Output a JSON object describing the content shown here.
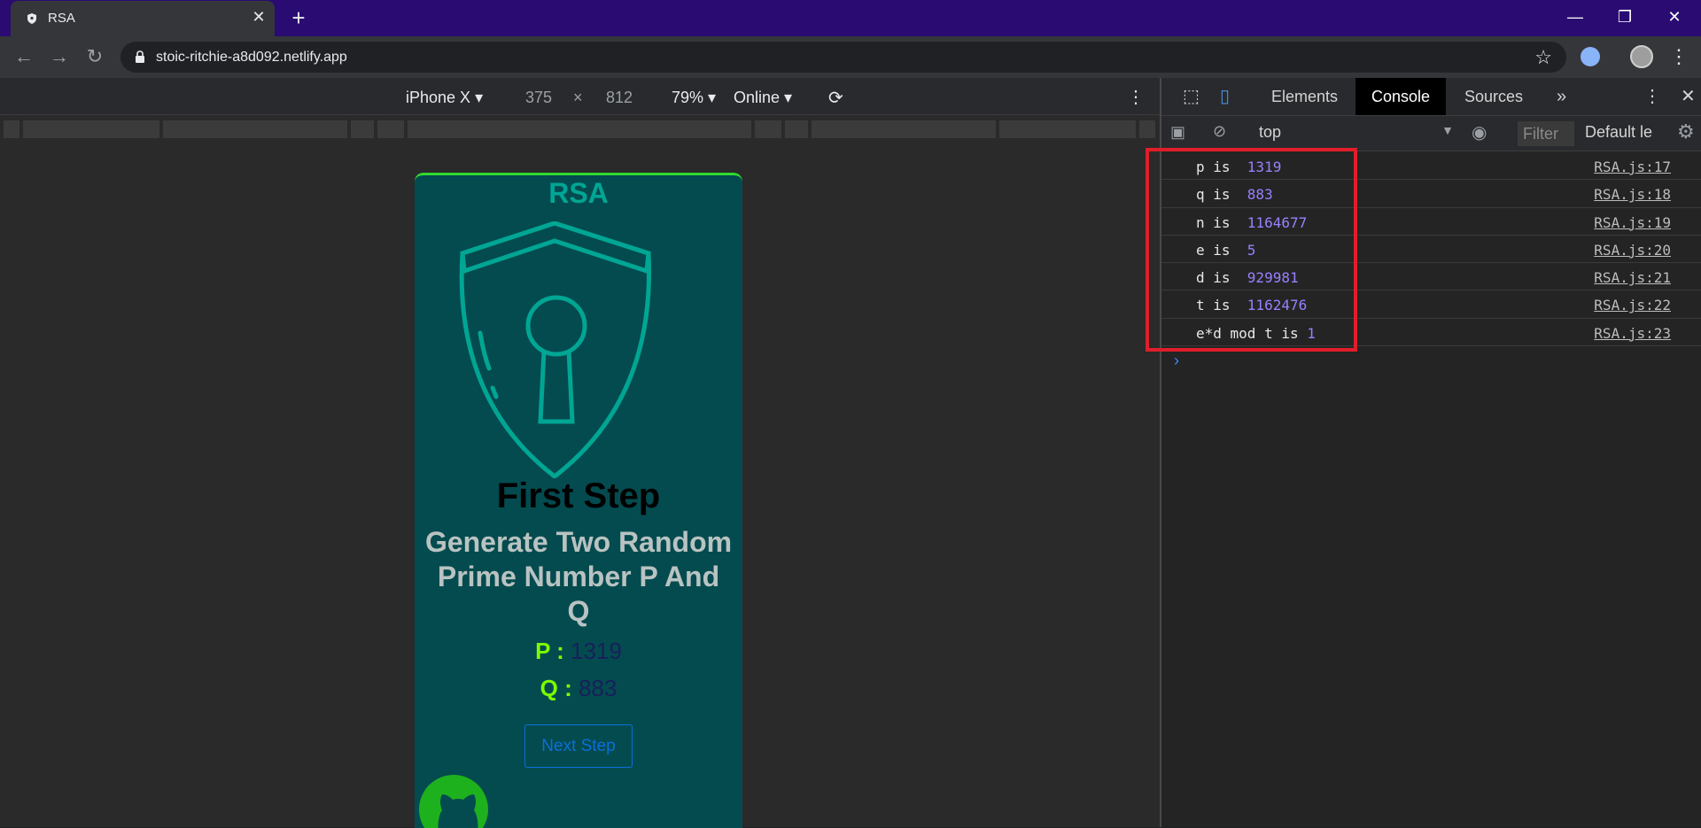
{
  "browser": {
    "tab_title": "RSA",
    "url": "stoic-ritchie-a8d092.netlify.app"
  },
  "device_toolbar": {
    "device": "iPhone X",
    "width": "375",
    "times": "×",
    "height": "812",
    "zoom": "79%",
    "network": "Online"
  },
  "app": {
    "title": "RSA",
    "step_title": "First Step",
    "step_desc": "Generate Two Random Prime Number P And Q",
    "p_label": "P :",
    "p_value": "1319",
    "q_label": "Q :",
    "q_value": "883",
    "next_button": "Next Step"
  },
  "devtools": {
    "tabs": [
      "Elements",
      "Console",
      "Sources"
    ],
    "more": "»",
    "context": "top",
    "filter_placeholder": "Filter",
    "level": "Default le",
    "logs": [
      {
        "label": "p is  ",
        "value": "1319",
        "source": "RSA.js:17"
      },
      {
        "label": "q is  ",
        "value": "883",
        "source": "RSA.js:18"
      },
      {
        "label": "n is  ",
        "value": "1164677",
        "source": "RSA.js:19"
      },
      {
        "label": "e is  ",
        "value": "5",
        "source": "RSA.js:20"
      },
      {
        "label": "d is  ",
        "value": "929981",
        "source": "RSA.js:21"
      },
      {
        "label": "t is  ",
        "value": "1162476",
        "source": "RSA.js:22"
      },
      {
        "label": "e*d mod t is ",
        "value": "1",
        "source": "RSA.js:23"
      }
    ],
    "prompt": "›"
  },
  "colors": {
    "titlebar": "#2a0b72",
    "app_bg": "#044b4f",
    "accent_teal": "#00a693",
    "pq_label": "#7cfc00",
    "highlight": "#e01e2a"
  }
}
